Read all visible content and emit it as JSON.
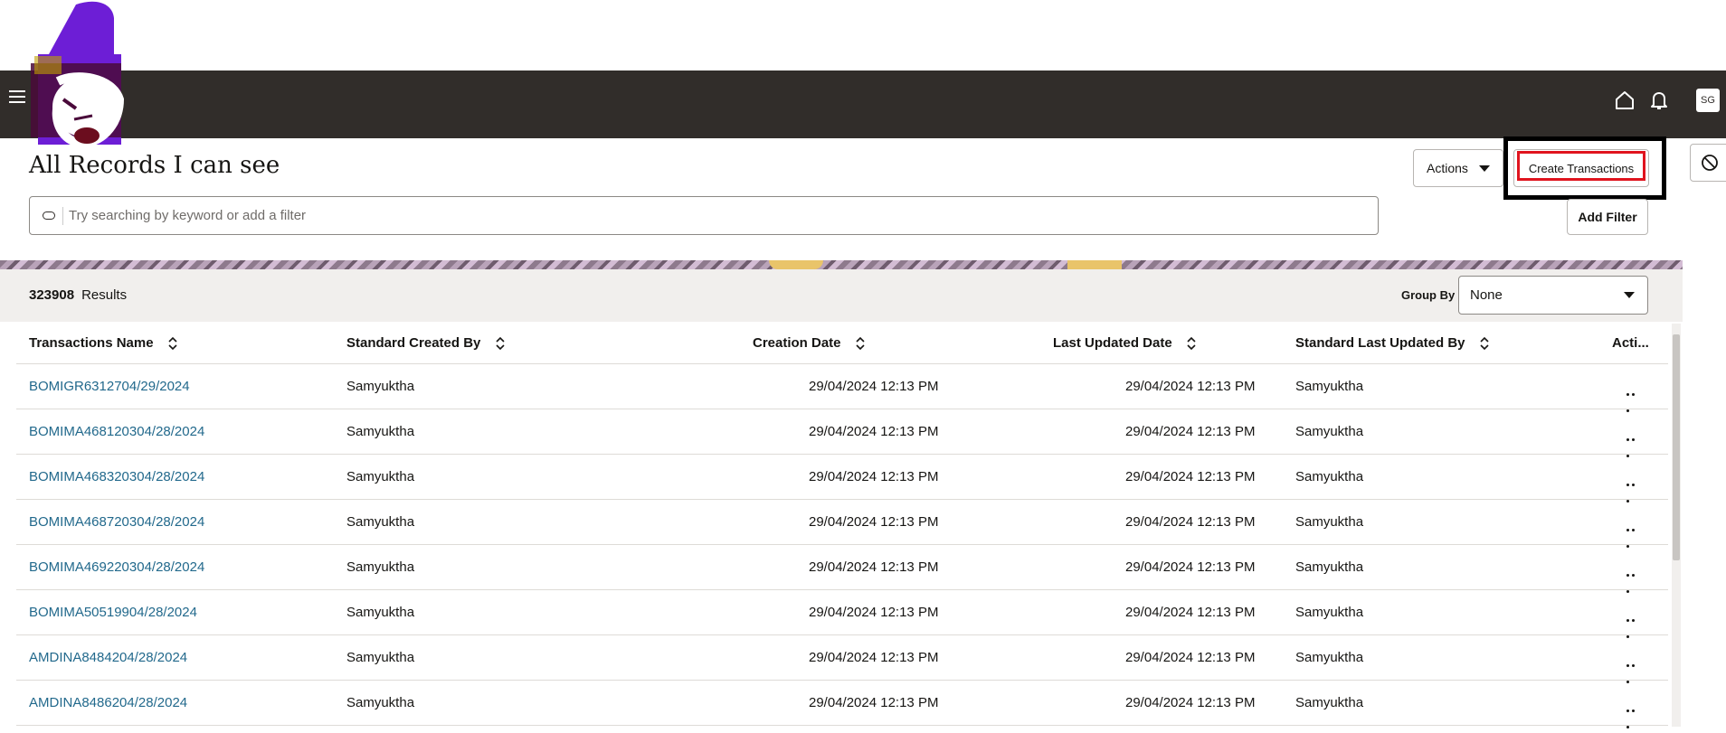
{
  "header": {
    "avatar_initials": "SG",
    "home_icon": "home-icon",
    "bell_icon": "bell-icon",
    "menu_icon": "hamburger-icon"
  },
  "page": {
    "title": "All Records I can see"
  },
  "toolbar": {
    "actions_label": "Actions",
    "create_label": "Create Transactions",
    "add_filter_label": "Add Filter"
  },
  "search": {
    "placeholder": "Try searching by keyword or add a filter"
  },
  "results": {
    "count": "323908",
    "label": "Results",
    "group_by_label": "Group By",
    "group_by_value": "None"
  },
  "table": {
    "columns": [
      "Transactions Name",
      "Standard Created By",
      "Creation Date",
      "Last Updated Date",
      "Standard Last Updated By",
      "Acti..."
    ],
    "rows": [
      {
        "name": "BOMIGR6312704/29/2024",
        "created_by": "Samyuktha",
        "creation_date": "29/04/2024 12:13 PM",
        "updated_date": "29/04/2024 12:13 PM",
        "updated_by": "Samyuktha"
      },
      {
        "name": "BOMIMA468120304/28/2024",
        "created_by": "Samyuktha",
        "creation_date": "29/04/2024 12:13 PM",
        "updated_date": "29/04/2024 12:13 PM",
        "updated_by": "Samyuktha"
      },
      {
        "name": "BOMIMA468320304/28/2024",
        "created_by": "Samyuktha",
        "creation_date": "29/04/2024 12:13 PM",
        "updated_date": "29/04/2024 12:13 PM",
        "updated_by": "Samyuktha"
      },
      {
        "name": "BOMIMA468720304/28/2024",
        "created_by": "Samyuktha",
        "creation_date": "29/04/2024 12:13 PM",
        "updated_date": "29/04/2024 12:13 PM",
        "updated_by": "Samyuktha"
      },
      {
        "name": "BOMIMA469220304/28/2024",
        "created_by": "Samyuktha",
        "creation_date": "29/04/2024 12:13 PM",
        "updated_date": "29/04/2024 12:13 PM",
        "updated_by": "Samyuktha"
      },
      {
        "name": "BOMIMA50519904/28/2024",
        "created_by": "Samyuktha",
        "creation_date": "29/04/2024 12:13 PM",
        "updated_date": "29/04/2024 12:13 PM",
        "updated_by": "Samyuktha"
      },
      {
        "name": "AMDINA8484204/28/2024",
        "created_by": "Samyuktha",
        "creation_date": "29/04/2024 12:13 PM",
        "updated_date": "29/04/2024 12:13 PM",
        "updated_by": "Samyuktha"
      },
      {
        "name": "AMDINA8486204/28/2024",
        "created_by": "Samyuktha",
        "creation_date": "29/04/2024 12:13 PM",
        "updated_date": "29/04/2024 12:13 PM",
        "updated_by": "Samyuktha"
      }
    ]
  },
  "colors": {
    "topbar": "#312d2a",
    "link": "#22698c",
    "highlight_red": "#e0141e"
  }
}
